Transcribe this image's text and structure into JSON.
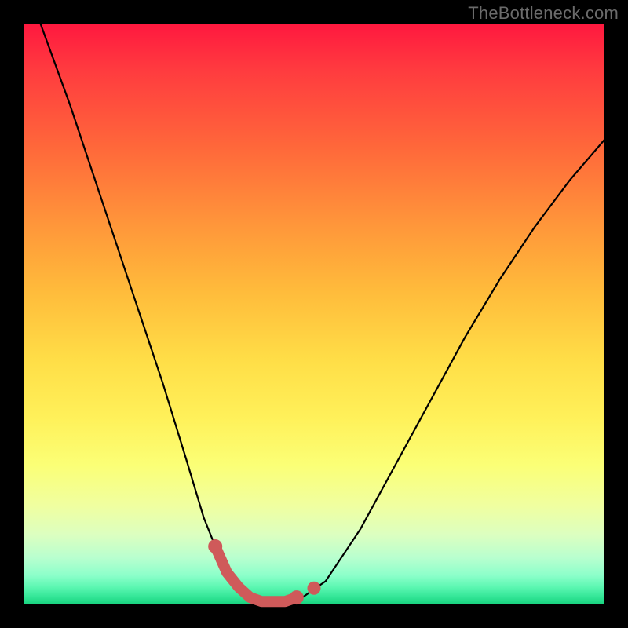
{
  "watermark": "TheBottleneck.com",
  "chart_data": {
    "type": "line",
    "title": "",
    "xlabel": "",
    "ylabel": "",
    "xlim": [
      0,
      1
    ],
    "ylim": [
      0,
      1
    ],
    "series": [
      {
        "name": "bottleneck-curve",
        "x": [
          0.0,
          0.04,
          0.08,
          0.12,
          0.16,
          0.2,
          0.24,
          0.28,
          0.31,
          0.33,
          0.35,
          0.37,
          0.39,
          0.42,
          0.45,
          0.48,
          0.52,
          0.58,
          0.64,
          0.7,
          0.76,
          0.82,
          0.88,
          0.94,
          1.0
        ],
        "values": [
          1.08,
          0.97,
          0.86,
          0.74,
          0.62,
          0.5,
          0.38,
          0.25,
          0.15,
          0.1,
          0.055,
          0.03,
          0.012,
          0.003,
          0.003,
          0.012,
          0.04,
          0.13,
          0.24,
          0.35,
          0.46,
          0.56,
          0.65,
          0.73,
          0.8
        ]
      }
    ],
    "highlight": {
      "x": [
        0.33,
        0.35,
        0.37,
        0.39,
        0.41,
        0.43,
        0.45,
        0.47
      ],
      "values": [
        0.1,
        0.055,
        0.03,
        0.012,
        0.005,
        0.005,
        0.005,
        0.012
      ],
      "extra_point": {
        "x": 0.5,
        "value": 0.028
      }
    },
    "colors": {
      "curve": "#000000",
      "highlight": "#cf5a5a"
    }
  }
}
